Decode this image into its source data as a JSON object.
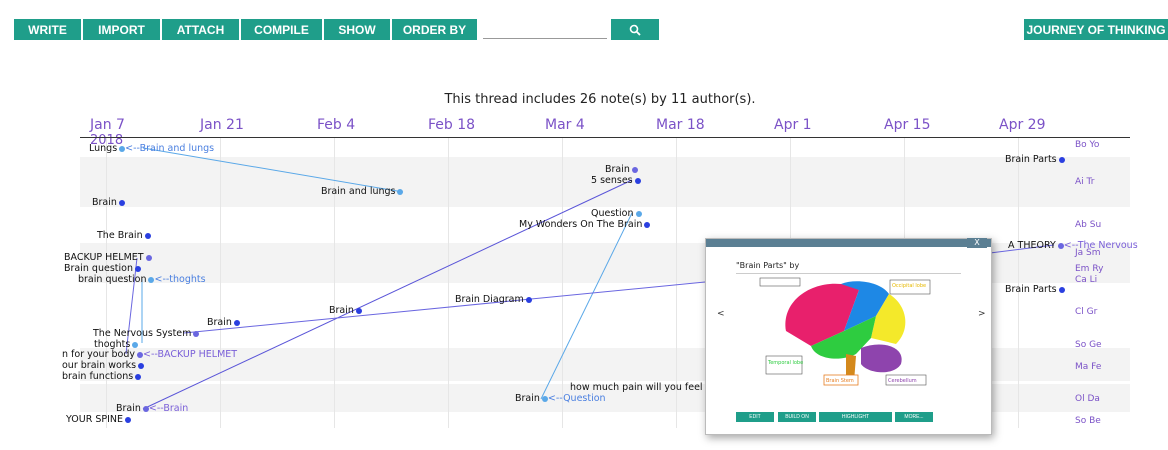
{
  "toolbar": {
    "buttons": [
      "WRITE",
      "IMPORT",
      "ATTACH",
      "COMPILE",
      "SHOW",
      "ORDER BY"
    ],
    "search_value": "",
    "search_icon": "search-icon",
    "journey": "JOURNEY OF THINKING",
    "accent_color": "#1f9e8a"
  },
  "summary": "This thread includes 26 note(s) by 11 author(s).",
  "timeline": {
    "dates": [
      "Jan 7",
      "Jan 21",
      "Feb 4",
      "Feb 18",
      "Mar 4",
      "Mar 18",
      "Apr 1",
      "Apr 15",
      "Apr 29"
    ],
    "year": "2018",
    "authors": [
      "Bo Yo",
      "Ai Tr",
      "Ab Su",
      "Ja Sm",
      "Em Ry",
      "Ca Li",
      "Cl Gr",
      "So Ge",
      "Ma Fe",
      "Ol Da",
      "So Be"
    ]
  },
  "notes": [
    {
      "title": "Lungs",
      "buildon": "<--Brain and lungs"
    },
    {
      "title": "Brain and lungs"
    },
    {
      "title": "Brain Parts"
    },
    {
      "title": "Brain"
    },
    {
      "title": "5 senses"
    },
    {
      "title": "Brain"
    },
    {
      "title": "Question"
    },
    {
      "title": "My Wonders On The Brain"
    },
    {
      "title": "The Brain"
    },
    {
      "title": "A THEORY",
      "buildon": "<--The Nervous"
    },
    {
      "title": "BACKUP HELMET"
    },
    {
      "title": "Brain question"
    },
    {
      "title": "brain question",
      "buildon": "<--thoghts"
    },
    {
      "title": "Brain Parts"
    },
    {
      "title": "Brain Diagram"
    },
    {
      "title": "Brain"
    },
    {
      "title": "Brain"
    },
    {
      "title": "The Nervous System"
    },
    {
      "title": "thoghts"
    },
    {
      "title": "n for your body",
      "buildon": "<--BACKUP HELMET"
    },
    {
      "title": "our brain works"
    },
    {
      "title": "brain functions"
    },
    {
      "title": "how much pain will you feel"
    },
    {
      "title": "Brain",
      "buildon": "<--Question"
    },
    {
      "title": "Brain",
      "buildon": "<--Brain"
    },
    {
      "title": "YOUR SPINE"
    }
  ],
  "popup": {
    "close": "X",
    "title": "\"Brain Parts\" by",
    "prev": "<",
    "next": ">",
    "image_labels": [
      "Temporal lobe",
      "Brain Stem",
      "Cerebellum",
      "Occipital lobe"
    ],
    "buttons": [
      "EDIT",
      "BUILD ON",
      "HIGHLIGHT",
      "MORE..."
    ]
  }
}
